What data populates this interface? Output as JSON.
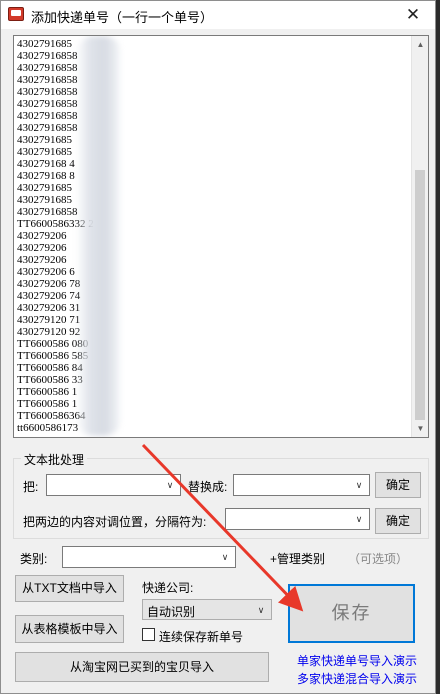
{
  "window": {
    "title": "添加快递单号（一行一个单号）",
    "close_glyph": "✕"
  },
  "tracking_list": {
    "lines": [
      "4302791685",
      "43027916858",
      "43027916858",
      "43027916858",
      "43027916858",
      "43027916858",
      "43027916858",
      "43027916858",
      "4302791685",
      "4302791685",
      "430279168   4",
      "430279168   8",
      "4302791685",
      "4302791685",
      "43027916858",
      "TT6600586332  2",
      "430279206",
      "430279206",
      "430279206",
      "430279206   6",
      "430279206   78",
      "430279206   74",
      "430279206   31",
      "430279120   71",
      "430279120   92",
      "TT6600586   080",
      "TT6600586   585",
      "TT6600586   84",
      "TT6600586   33",
      "TT6600586   1",
      "TT6600586   1",
      "TT6600586364",
      "tt6600586173"
    ],
    "scroll_up": "▲",
    "scroll_down": "▼"
  },
  "batch": {
    "title": "文本批处理",
    "replace_label": "把:",
    "replace_with_label": "替换成:",
    "confirm": "确定",
    "swap_label": "把两边的内容对调位置，分隔符为:",
    "combo_arrow": "∨"
  },
  "category": {
    "label": "类别:",
    "manage": "+管理类别",
    "optional": "（可选项）"
  },
  "imports": {
    "from_txt": "从TXT文档中导入",
    "from_template": "从表格模板中导入",
    "from_taobao": "从淘宝网已买到的宝贝导入"
  },
  "courier": {
    "label": "快递公司:",
    "selected": "自动识别"
  },
  "continuous_save": {
    "label": "连续保存新单号",
    "checked": false
  },
  "save_button": "保存",
  "links": {
    "single_demo": "单家快递单号导入演示",
    "mixed_demo": "多家快递混合导入演示"
  },
  "colors": {
    "accent": "#0078d7",
    "link": "#0000ee",
    "annotation_arrow": "#e8382a"
  }
}
